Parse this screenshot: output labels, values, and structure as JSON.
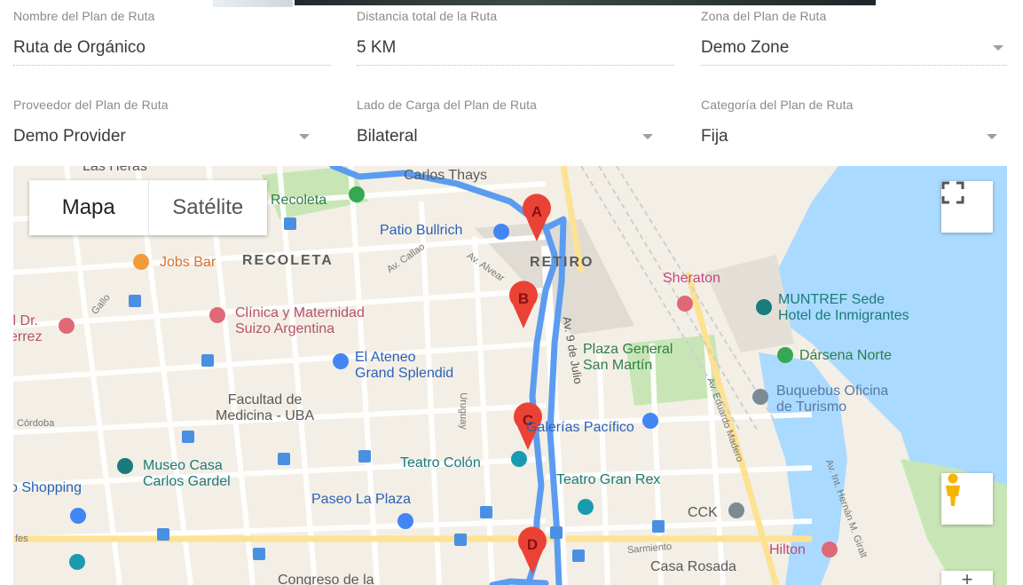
{
  "form": {
    "route_name": {
      "label": "Nombre del Plan de Ruta",
      "value": "Ruta de Orgánico"
    },
    "total_distance": {
      "label": "Distancia total de la Ruta",
      "value": "5 KM"
    },
    "zone": {
      "label": "Zona del Plan de Ruta",
      "value": "Demo Zone"
    },
    "provider": {
      "label": "Proveedor del Plan de Ruta",
      "value": "Demo Provider"
    },
    "loading_side": {
      "label": "Lado de Carga del Plan de Ruta",
      "value": "Bilateral"
    },
    "category": {
      "label": "Categoría del Plan de Ruta",
      "value": "Fija"
    }
  },
  "map": {
    "type_controls": {
      "map": "Mapa",
      "satellite": "Satélite"
    },
    "icons": {
      "fullscreen": "fullscreen-icon",
      "pegman": "pegman-icon",
      "marker": "map-marker-icon"
    },
    "colors": {
      "route": "#5b9cf0",
      "marker": "#ea4335",
      "water": "#aadaff",
      "park": "#c8e6b5"
    },
    "markers": [
      "A",
      "B",
      "C",
      "D"
    ],
    "labels": {
      "las_heras": "Las Heras",
      "carlos_thays": "Carlos Thays",
      "recoleta_place": "Recoleta",
      "patio_bullrich": "Patio Bullrich",
      "jobs_bar": "Jobs Bar",
      "recoleta_district": "RECOLETA",
      "retiro_district": "RETIRO",
      "sheraton": "Sheraton",
      "muntref": "MUNTREF Sede\nHotel de Inmigrantes",
      "clinica": "Clínica y Maternidad\nSuizo Argentina",
      "dr": "il Dr.\nerrez",
      "el_ateneo": "El Ateneo\nGrand Splendid",
      "plaza_general": "Plaza General\nSan Martín",
      "darsena": "Dársena Norte",
      "buquebus": "Buquebus Oficina\nde Turismo",
      "facultad": "Facultad de\nMedicina - UBA",
      "cordoba": "Córdoba",
      "galerias": "Galerías Pacífico",
      "museo": "Museo Casa\nCarlos Gardel",
      "teatro_colon": "Teatro Colón",
      "teatro_gran_rex": "Teatro Gran Rex",
      "shopping": "o Shopping",
      "paseo": "Paseo La Plaza",
      "cck": "CCK",
      "hilton": "Hilton",
      "casa_rosada": "Casa Rosada",
      "congreso": "Congreso de la",
      "av_callao": "Av. Callao",
      "av_alvear": "Av. Alvear",
      "av_9_julio": "Av. 9 de Julio",
      "uruguay": "Uruguay",
      "av_eduardo_madero": "Av. Eduardo Madero",
      "av_hernan": "Av. Int. Hernán M. Giralt",
      "sarmiento": "Sarmiento",
      "gallo": "Gallo",
      "fes": "fes"
    }
  }
}
